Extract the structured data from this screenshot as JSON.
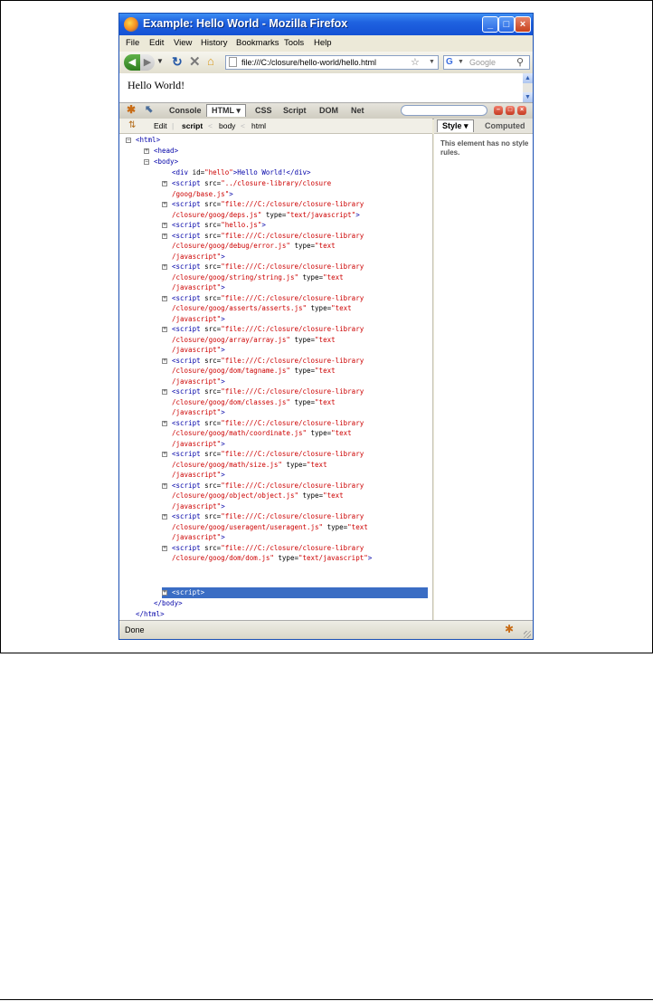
{
  "window": {
    "title": "Example: Hello World - Mozilla Firefox",
    "buttons": {
      "minimize": "_",
      "maximize": "□",
      "close": "×"
    }
  },
  "menu": [
    "File",
    "Edit",
    "View",
    "History",
    "Bookmarks",
    "Tools",
    "Help"
  ],
  "navigation": {
    "url": "file:///C:/closure/hello-world/hello.html",
    "search_placeholder": "Google"
  },
  "page": {
    "text": "Hello World!"
  },
  "firebug": {
    "tabs": [
      "Console",
      "HTML",
      "CSS",
      "Script",
      "DOM",
      "Net"
    ],
    "active_tab": "HTML",
    "breadcrumb": {
      "edit": "Edit",
      "items": [
        "script",
        "body",
        "html"
      ]
    },
    "side_tabs": [
      "Style",
      "Computed"
    ],
    "active_side_tab": "Style",
    "style_message": "This element has no style rules.",
    "tree": {
      "html_open": "<html>",
      "head": "<head>",
      "body_open": "<body>",
      "div": {
        "open": "<div",
        "attr": " id=",
        "val": "\"hello\"",
        "text": ">Hello World!</div>"
      },
      "scripts": [
        {
          "l1a": "<script",
          "l1b": " src=",
          "l1c": "\"../closure-library/closure",
          "l2": "/goog/base.js\"",
          "l2b": ">"
        },
        {
          "l1a": "<script",
          "l1b": " src=",
          "l1c": "\"file:///C:/closure/closure-library",
          "l2": "/closure/goog/deps.js\"",
          "l2b": " type=",
          "l2c": "\"text/javascript\"",
          "l2d": ">"
        },
        {
          "l1a": "<script",
          "l1b": " src=",
          "l1c": "\"hello.js\"",
          "l1d": ">"
        },
        {
          "l1a": "<script",
          "l1b": " src=",
          "l1c": "\"file:///C:/closure/closure-library",
          "l2": "/closure/goog/debug/error.js\"",
          "l2b": " type=",
          "l2c": "\"text",
          "l3": "/javascript\"",
          "l3b": ">"
        },
        {
          "l1a": "<script",
          "l1b": " src=",
          "l1c": "\"file:///C:/closure/closure-library",
          "l2": "/closure/goog/string/string.js\"",
          "l2b": " type=",
          "l2c": "\"text",
          "l3": "/javascript\"",
          "l3b": ">"
        },
        {
          "l1a": "<script",
          "l1b": " src=",
          "l1c": "\"file:///C:/closure/closure-library",
          "l2": "/closure/goog/asserts/asserts.js\"",
          "l2b": " type=",
          "l2c": "\"text",
          "l3": "/javascript\"",
          "l3b": ">"
        },
        {
          "l1a": "<script",
          "l1b": " src=",
          "l1c": "\"file:///C:/closure/closure-library",
          "l2": "/closure/goog/array/array.js\"",
          "l2b": " type=",
          "l2c": "\"text",
          "l3": "/javascript\"",
          "l3b": ">"
        },
        {
          "l1a": "<script",
          "l1b": " src=",
          "l1c": "\"file:///C:/closure/closure-library",
          "l2": "/closure/goog/dom/tagname.js\"",
          "l2b": " type=",
          "l2c": "\"text",
          "l3": "/javascript\"",
          "l3b": ">"
        },
        {
          "l1a": "<script",
          "l1b": " src=",
          "l1c": "\"file:///C:/closure/closure-library",
          "l2": "/closure/goog/dom/classes.js\"",
          "l2b": " type=",
          "l2c": "\"text",
          "l3": "/javascript\"",
          "l3b": ">"
        },
        {
          "l1a": "<script",
          "l1b": " src=",
          "l1c": "\"file:///C:/closure/closure-library",
          "l2": "/closure/goog/math/coordinate.js\"",
          "l2b": " type=",
          "l2c": "\"text",
          "l3": "/javascript\"",
          "l3b": ">"
        },
        {
          "l1a": "<script",
          "l1b": " src=",
          "l1c": "\"file:///C:/closure/closure-library",
          "l2": "/closure/goog/math/size.js\"",
          "l2b": " type=",
          "l2c": "\"text",
          "l3": "/javascript\"",
          "l3b": ">"
        },
        {
          "l1a": "<script",
          "l1b": " src=",
          "l1c": "\"file:///C:/closure/closure-library",
          "l2": "/closure/goog/object/object.js\"",
          "l2b": " type=",
          "l2c": "\"text",
          "l3": "/javascript\"",
          "l3b": ">"
        },
        {
          "l1a": "<script",
          "l1b": " src=",
          "l1c": "\"file:///C:/closure/closure-library",
          "l2": "/closure/goog/useragent/useragent.js\"",
          "l2b": " type=",
          "l2c": "\"text",
          "l3": "/javascript\"",
          "l3b": ">"
        },
        {
          "l1a": "<script",
          "l1b": " src=",
          "l1c": "\"file:///C:/closure/closure-library",
          "l2": "/closure/goog/dom/dom.js\"",
          "l2b": " type=",
          "l2c": "\"text/javascript\"",
          "l2d": ">"
        }
      ],
      "selected_script": "<script>",
      "body_close": "</body>",
      "html_close": "</html>"
    }
  },
  "status": {
    "text": "Done"
  },
  "colors": {
    "tag": "#0000a8",
    "value": "#cc0000",
    "selection": "#3a6dc4",
    "titlebar": "#1f62e0"
  }
}
